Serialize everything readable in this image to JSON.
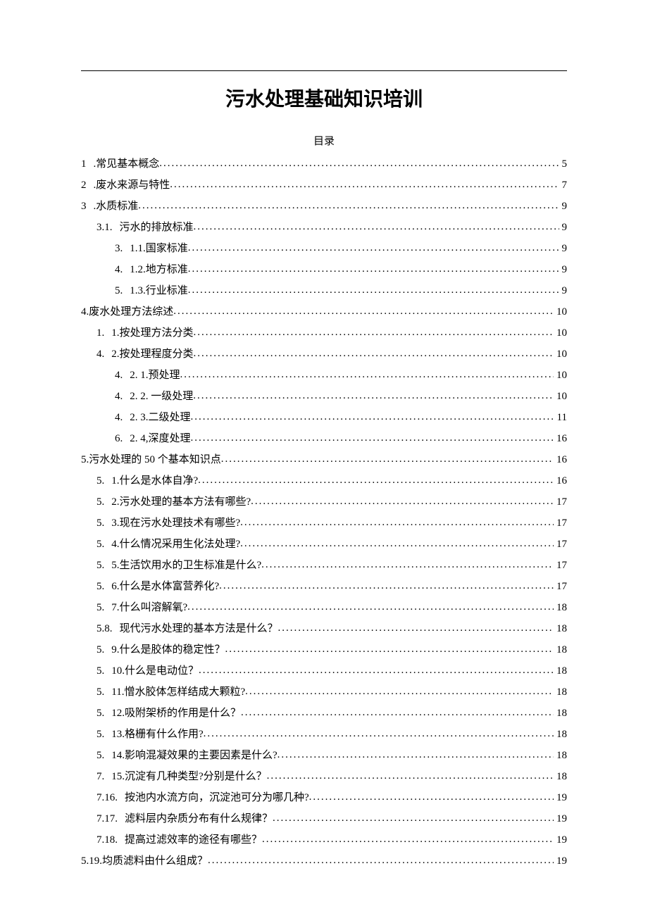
{
  "title": "污水处理基础知识培训",
  "toc_label": "目录",
  "toc": [
    {
      "marker": "1",
      "text": ".常见基本概念",
      "page": "5",
      "indent": "ind0"
    },
    {
      "marker": "2",
      "text": ".废水来源与特性",
      "page": "7",
      "indent": "ind0"
    },
    {
      "marker": "3",
      "text": ".水质标准",
      "page": "9",
      "indent": "ind0"
    },
    {
      "marker": "3.1.",
      "text": "污水的排放标准",
      "page": "9",
      "indent": "ind1"
    },
    {
      "marker": "3.",
      "text": "1.1.国家标准",
      "page": "9",
      "indent": "ind2"
    },
    {
      "marker": "4.",
      "text": "1.2.地方标准",
      "page": "9",
      "indent": "ind2"
    },
    {
      "marker": "5.",
      "text": "1.3.行业标准",
      "page": "9",
      "indent": "ind2"
    },
    {
      "marker": "",
      "text": "4.废水处理方法综述",
      "page": "10",
      "indent": "ind0b"
    },
    {
      "marker": "1.",
      "text": "1.按处理方法分类",
      "page": "10",
      "indent": "ind1"
    },
    {
      "marker": "4.",
      "text": "2.按处理程度分类",
      "page": "10",
      "indent": "ind1"
    },
    {
      "marker": "4.",
      "text": "2. 1.预处理",
      "page": "10",
      "indent": "ind2"
    },
    {
      "marker": "4.",
      "text": "2. 2. 一级处理",
      "page": "10",
      "indent": "ind2"
    },
    {
      "marker": "4.",
      "text": "2. 3.二级处理",
      "page": "11",
      "indent": "ind2"
    },
    {
      "marker": "6.",
      "text": "2. 4,深度处理",
      "page": "16",
      "indent": "ind2"
    },
    {
      "marker": "",
      "text": "5.污水处理的 50 个基本知识点",
      "page": "16",
      "indent": "ind0b"
    },
    {
      "marker": "5.",
      "text": "1.什么是水体自净?",
      "page": "16",
      "indent": "ind1"
    },
    {
      "marker": "5.",
      "text": "2.污水处理的基本方法有哪些?",
      "page": "17",
      "indent": "ind1"
    },
    {
      "marker": "5.",
      "text": "3.现在污水处理技术有哪些?",
      "page": "17",
      "indent": "ind1"
    },
    {
      "marker": "5.",
      "text": "4.什么情况采用生化法处理?",
      "page": "17",
      "indent": "ind1"
    },
    {
      "marker": "5.",
      "text": "5.生活饮用水的卫生标准是什么?",
      "page": "17",
      "indent": "ind1"
    },
    {
      "marker": "5.",
      "text": "6.什么是水体富营养化?",
      "page": "17",
      "indent": "ind1"
    },
    {
      "marker": "5.",
      "text": "7.什么叫溶解氧?",
      "page": "18",
      "indent": "ind1"
    },
    {
      "marker": "5.8.",
      "text": "现代污水处理的基本方法是什么？",
      "page": "18",
      "indent": "ind1"
    },
    {
      "marker": "5.",
      "text": "9.什么是胶体的稳定性？",
      "page": "18",
      "indent": "ind1"
    },
    {
      "marker": "5.",
      "text": "10.什么是电动位？",
      "page": "18",
      "indent": "ind1"
    },
    {
      "marker": "5.",
      "text": "11.憎水胶体怎样结成大颗粒?",
      "page": "18",
      "indent": "ind1"
    },
    {
      "marker": "5.",
      "text": "12.吸附架桥的作用是什么？",
      "page": "18",
      "indent": "ind1"
    },
    {
      "marker": "5.",
      "text": "13.格栅有什么作用?",
      "page": "18",
      "indent": "ind1"
    },
    {
      "marker": "5.",
      "text": "14.影响混凝效果的主要因素是什么?",
      "page": "18",
      "indent": "ind1"
    },
    {
      "marker": "7.",
      "text": "15.沉淀有几种类型?分别是什么？",
      "page": "18",
      "indent": "ind1"
    },
    {
      "marker": "7.16.",
      "text": "按池内水流方向，沉淀池可分为哪几种?",
      "page": "19",
      "indent": "ind1"
    },
    {
      "marker": "7.17.",
      "text": "滤料层内杂质分布有什么规律？",
      "page": "19",
      "indent": "ind1"
    },
    {
      "marker": "7.18.",
      "text": "提高过滤效率的途径有哪些？",
      "page": "19",
      "indent": "ind1"
    },
    {
      "marker": "",
      "text": "5.19.均质滤料由什么组成？",
      "page": "19",
      "indent": "ind0b"
    }
  ]
}
